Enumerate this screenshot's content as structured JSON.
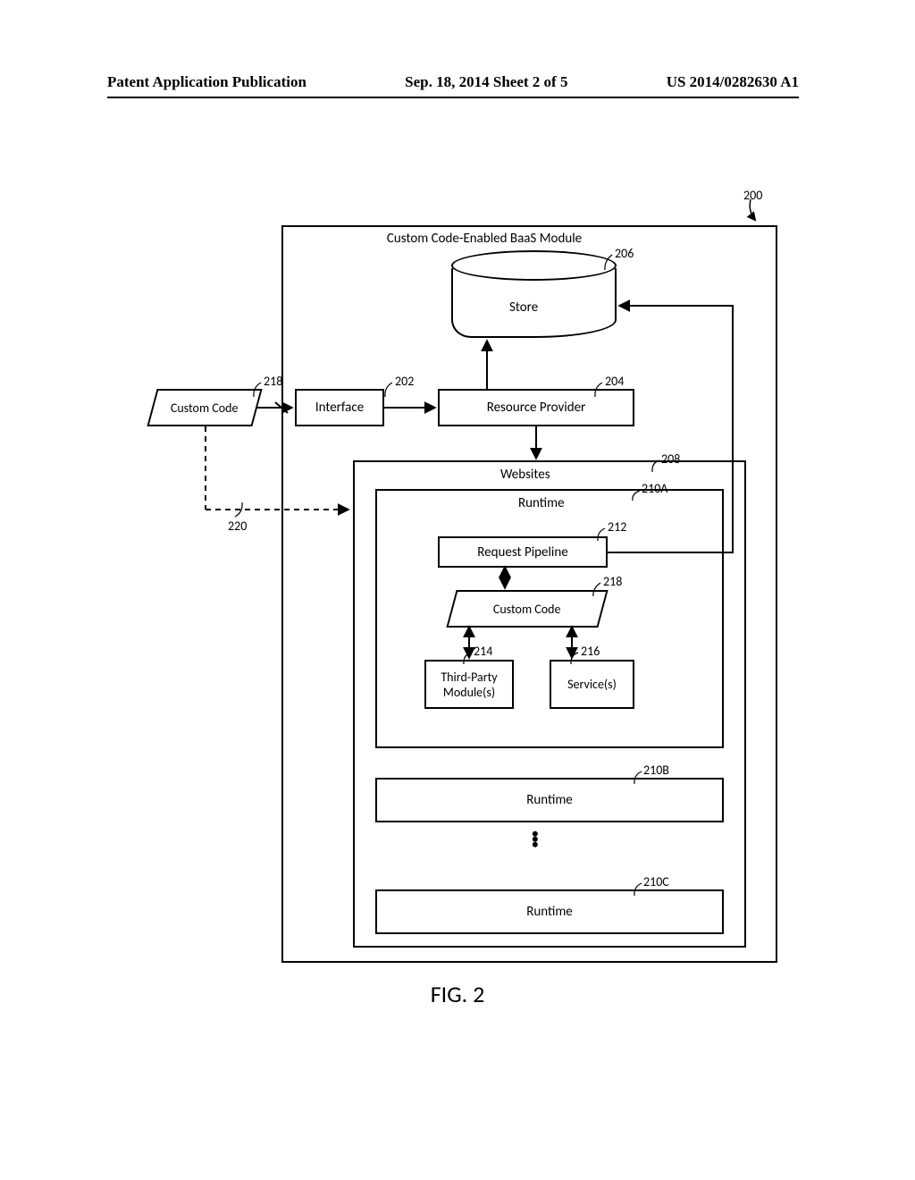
{
  "header": {
    "left": "Patent Application Publication",
    "center": "Sep. 18, 2014  Sheet 2 of 5",
    "right": "US 2014/0282630 A1"
  },
  "refs": {
    "r200": "200",
    "r206": "206",
    "r218a": "218",
    "r202": "202",
    "r204": "204",
    "r208": "208",
    "r210a": "210A",
    "r212": "212",
    "r218b": "218",
    "r214": "214",
    "r216": "216",
    "r210b": "210B",
    "r210c": "210C",
    "r220": "220"
  },
  "labels": {
    "module_title": "Custom Code-Enabled BaaS Module",
    "store": "Store",
    "interface": "Interface",
    "resource_provider": "Resource Provider",
    "custom_code": "Custom Code",
    "websites": "Websites",
    "runtime": "Runtime",
    "request_pipeline": "Request Pipeline",
    "third_party": "Third-Party Module(s)",
    "services": "Service(s)"
  },
  "caption": "FIG. 2"
}
